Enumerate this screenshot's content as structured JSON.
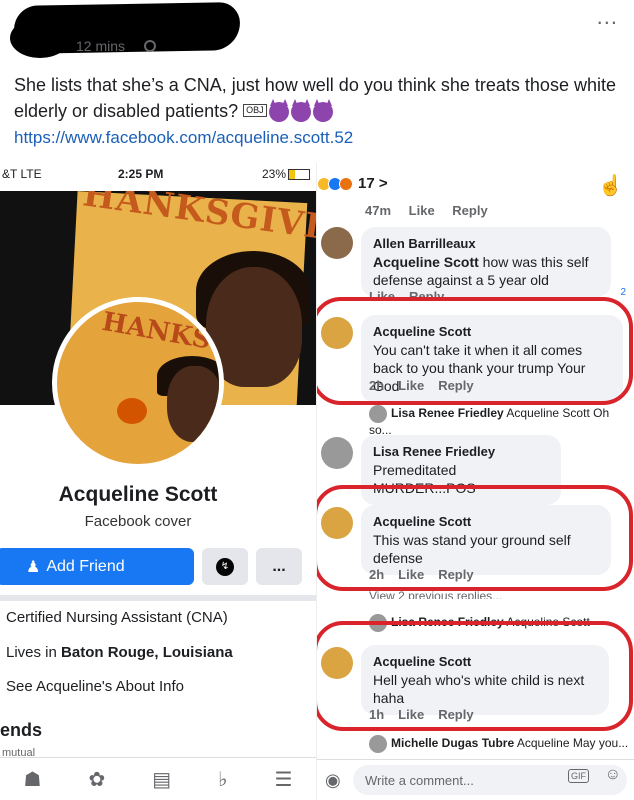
{
  "post": {
    "time": "12 mins",
    "text": "She lists that she’s a CNA, just how well do you think she treats those white elderly or disabled patients?",
    "emoji_placeholder": "OBJ",
    "link": "https://www.facebook.com/acqueline.scott.52",
    "more": "..."
  },
  "left": {
    "status": {
      "carrier": "&T  LTE",
      "time": "2:25 PM",
      "battery": "23%"
    },
    "cover_text": "HANKSGIVIN",
    "profile_pic_text": "HANKSGIVI",
    "name": "Acqueline Scott",
    "subtitle": "Facebook  cover",
    "add_friend": "Add Friend",
    "more_button": "...",
    "info": [
      {
        "text": "Certified Nursing Assistant (CNA)",
        "bold": ""
      },
      {
        "text": "Lives in ",
        "bold": "Baton Rouge, Louisiana"
      },
      {
        "text": "See Acqueline's About Info",
        "bold": ""
      }
    ],
    "friends_heading": "ends",
    "friends_sub": "mutual"
  },
  "right": {
    "react_count": "17 >",
    "top_meta": {
      "time": "47m",
      "like": "Like",
      "reply": "Reply"
    },
    "comments": [
      {
        "author": "Allen Barrilleaux",
        "mention": "Acqueline Scott",
        "text": " how was this self defense against a 5 year old"
      },
      {
        "author": "Acqueline Scott",
        "text": "You  can't  take it  when it  all comes back to you  thank  your  trump Your God",
        "time": "2h",
        "like": "Like",
        "reply": "Reply"
      },
      {
        "author": "Lisa Renee Friedley",
        "mention": "Acqueline Scott",
        "text": " Oh so..."
      },
      {
        "author": "Lisa Renee Friedley",
        "text": "Premeditated MURDER...POS"
      },
      {
        "author": "Acqueline Scott",
        "text": "This was stand  your  ground  self defense",
        "time": "2h",
        "like": "Like",
        "reply": "Reply"
      },
      {
        "author": "Lisa Renee Friedley",
        "mention": "Acqueline Scott"
      },
      {
        "author": "Acqueline Scott",
        "text": "Hell yeah  who's  white  child is  next haha",
        "time": "1h",
        "like": "Like",
        "reply": "Reply"
      },
      {
        "author": "Michelle Dugas Tubre",
        "mention": "Acqueline May you..."
      }
    ],
    "partial": {
      "like": "Like",
      "reply": "Reply",
      "view_prev": "View 2 previous replies..."
    },
    "reaction_badge": "2",
    "input_placeholder": "Write a comment...",
    "gif": "GIF"
  },
  "colors": {
    "accent": "#1877f2",
    "highlight": "#d8242a",
    "link": "#1b5fb8"
  }
}
